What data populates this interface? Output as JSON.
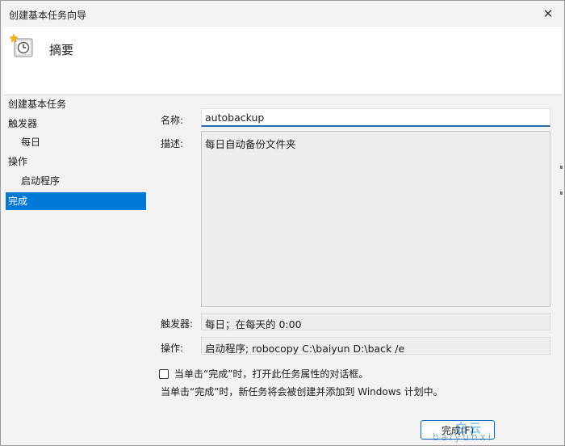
{
  "window": {
    "title": "创建基本任务向导",
    "close_glyph": "✕"
  },
  "header": {
    "title": "摘要",
    "icon": "task-scheduler-clock-icon"
  },
  "nav": {
    "items": [
      {
        "label": "创建基本任务",
        "level": 0,
        "selected": false
      },
      {
        "label": "触发器",
        "level": 0,
        "selected": false
      },
      {
        "label": "每日",
        "level": 1,
        "selected": false
      },
      {
        "label": "操作",
        "level": 0,
        "selected": false
      },
      {
        "label": "启动程序",
        "level": 1,
        "selected": false
      },
      {
        "label": "完成",
        "level": 0,
        "selected": true
      }
    ]
  },
  "form": {
    "name_label": "名称:",
    "name_value": "autobackup",
    "desc_label": "描述:",
    "desc_value": "每日自动备份文件夹",
    "trigger_label": "触发器:",
    "trigger_value": "每日；在每天的 0:00",
    "action_label": "操作:",
    "action_value": "启动程序; robocopy C:\\baiyun D:\\back /e",
    "open_props_label": "当单击“完成”时，打开此任务属性的对话框。",
    "info_text": "当单击“完成”时，新任务将会被创建并添加到 Windows 计划中。"
  },
  "buttons": {
    "finish_label": "完成(F)"
  },
  "watermark": {
    "main": "白云",
    "sub": "baiyunxi"
  },
  "colors": {
    "selection": "#0078d7",
    "focus_underline": "#2b6cb0",
    "button_border": "#0067c0"
  }
}
